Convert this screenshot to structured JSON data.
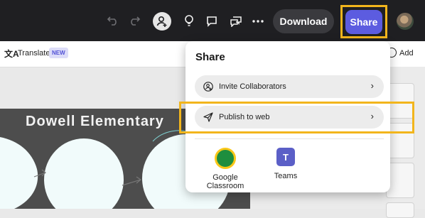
{
  "topbar": {
    "download_label": "Download",
    "share_label": "Share",
    "icons": [
      "undo-icon",
      "redo-icon",
      "add-person-icon",
      "lightbulb-icon",
      "comment-icon",
      "chat-icon",
      "more-icon"
    ]
  },
  "toolbar": {
    "translate_label": "Translate",
    "new_badge": "NEW",
    "add_label": "Add"
  },
  "canvas": {
    "slide_title": "Dowell Elementary"
  },
  "share_panel": {
    "title": "Share",
    "items": [
      {
        "label": "Invite Collaborators",
        "icon": "add-person-icon"
      },
      {
        "label": "Publish to web",
        "icon": "send-icon"
      }
    ],
    "apps": [
      {
        "label": "Google Classroom",
        "icon": "google-classroom-icon"
      },
      {
        "label": "Teams",
        "icon": "teams-icon"
      }
    ]
  },
  "colors": {
    "topbar_bg": "#1f1f22",
    "share_button": "#5c5ce0",
    "highlight": "#f2b51c"
  }
}
